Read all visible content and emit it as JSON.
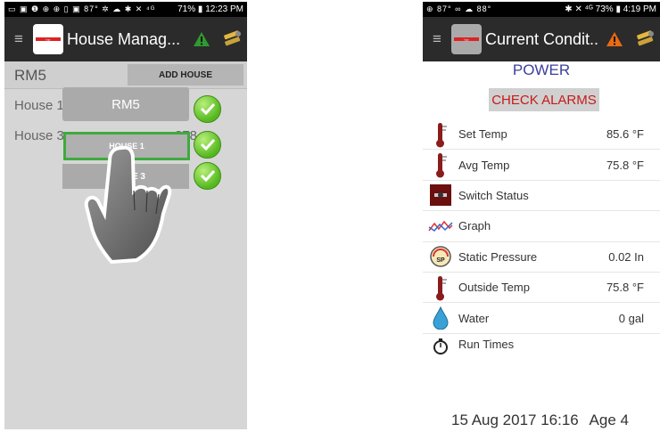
{
  "left_screen": {
    "status_bar": {
      "left_icons": "▭ ▣ ❶ ⊕ ⊕ ▯ ▣ 87° ✲ ☁ ✱ ✕ ⁴ᴳ",
      "battery": "71%",
      "time": "12:23 PM"
    },
    "toolbar": {
      "title": "House Manag...",
      "menu_icon": "menu-icon",
      "alert_icon": "green-warning-icon",
      "settings_icon": "tools-icon"
    },
    "header": {
      "room": "RM5",
      "add_house_label": "ADD HOUSE"
    },
    "houses": [
      {
        "label": "House 1",
        "trail": "3"
      },
      {
        "label": "House 3",
        "trail": "378"
      }
    ],
    "popup": {
      "title": "RM5",
      "options": [
        "HOUSE 1",
        "HOUSE 3"
      ]
    }
  },
  "right_screen": {
    "status_bar": {
      "left_icons": "⊕ 87° ∞ ☁ 88°",
      "battery": "73%",
      "time": "4:19 PM"
    },
    "toolbar": {
      "title": "Current Condit...",
      "menu_icon": "menu-icon",
      "alert_icon": "orange-warning-icon",
      "settings_icon": "tools-icon"
    },
    "section_title": "POWER",
    "check_alarms_label": "CHECK ALARMS",
    "rows": [
      {
        "label": "Set Temp",
        "value": "85.6 °F",
        "icon": "thermometer-icon"
      },
      {
        "label": "Avg Temp",
        "value": "75.8 °F",
        "icon": "thermometer-icon"
      },
      {
        "label": "Switch Status",
        "value": "",
        "icon": "switch-icon"
      },
      {
        "label": "Graph",
        "value": "",
        "icon": "graph-icon"
      },
      {
        "label": "Static Pressure",
        "value": "0.02 In",
        "icon": "pressure-gauge-icon"
      },
      {
        "label": "Outside Temp",
        "value": "75.8 °F",
        "icon": "thermometer-icon"
      },
      {
        "label": "Water",
        "value": "0 gal",
        "icon": "water-drop-icon"
      },
      {
        "label": "Run Times",
        "value": "",
        "icon": "stopwatch-icon"
      }
    ],
    "footer": {
      "timestamp": "15 Aug 2017 16:16",
      "age": "Age 4"
    }
  },
  "colors": {
    "toolbar": "#2b2b2b",
    "accent_blue": "#3b3f9e",
    "alarm_red": "#c61b1b",
    "check_green": "#54b81f"
  }
}
